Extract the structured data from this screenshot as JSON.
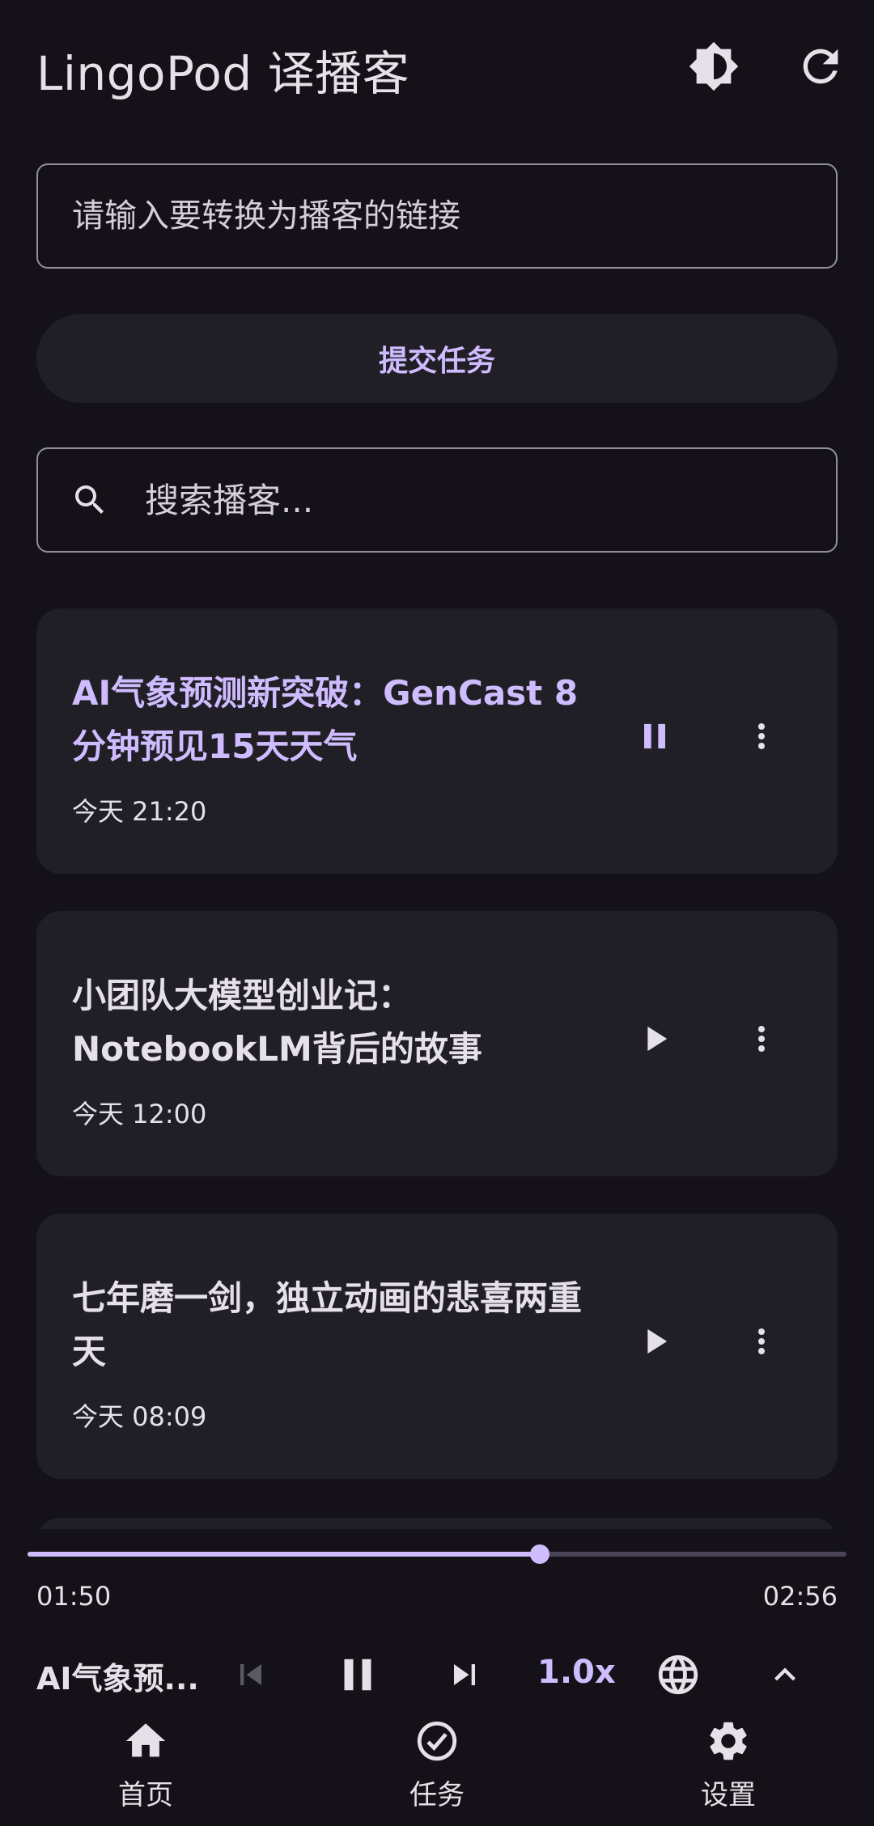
{
  "app": {
    "title": "LingoPod 译播客"
  },
  "appbar": {
    "theme_icon": "brightness-icon",
    "refresh_icon": "refresh-icon"
  },
  "url_input": {
    "placeholder": "请输入要转换为播客的链接",
    "value": ""
  },
  "submit": {
    "label": "提交任务"
  },
  "search": {
    "placeholder": "搜索播客...",
    "value": "",
    "icon": "search-icon"
  },
  "podcasts": [
    {
      "title": "AI气象预测新突破：GenCast 8分钟预见15天天气",
      "time": "今天 21:20",
      "state": "playing"
    },
    {
      "title": "小团队大模型创业记：NotebookLM背后的故事",
      "time": "今天 12:00",
      "state": "paused"
    },
    {
      "title": "七年磨一剑，独立动画的悲喜两重天",
      "time": "今天 08:09",
      "state": "paused"
    }
  ],
  "player": {
    "now_playing": "AI气象预...",
    "elapsed": "01:50",
    "total": "02:56",
    "progress": 0.625,
    "speed": "1.0x"
  },
  "nav": {
    "items": [
      {
        "label": "首页",
        "icon": "home-icon",
        "active": true
      },
      {
        "label": "任务",
        "icon": "task-check-icon",
        "active": false
      },
      {
        "label": "设置",
        "icon": "gear-icon",
        "active": false
      }
    ]
  },
  "colors": {
    "background": "#141218",
    "surface": "#211f26",
    "accent": "#cfbcff",
    "text": "#e6e0e9",
    "outline": "#938f99"
  }
}
